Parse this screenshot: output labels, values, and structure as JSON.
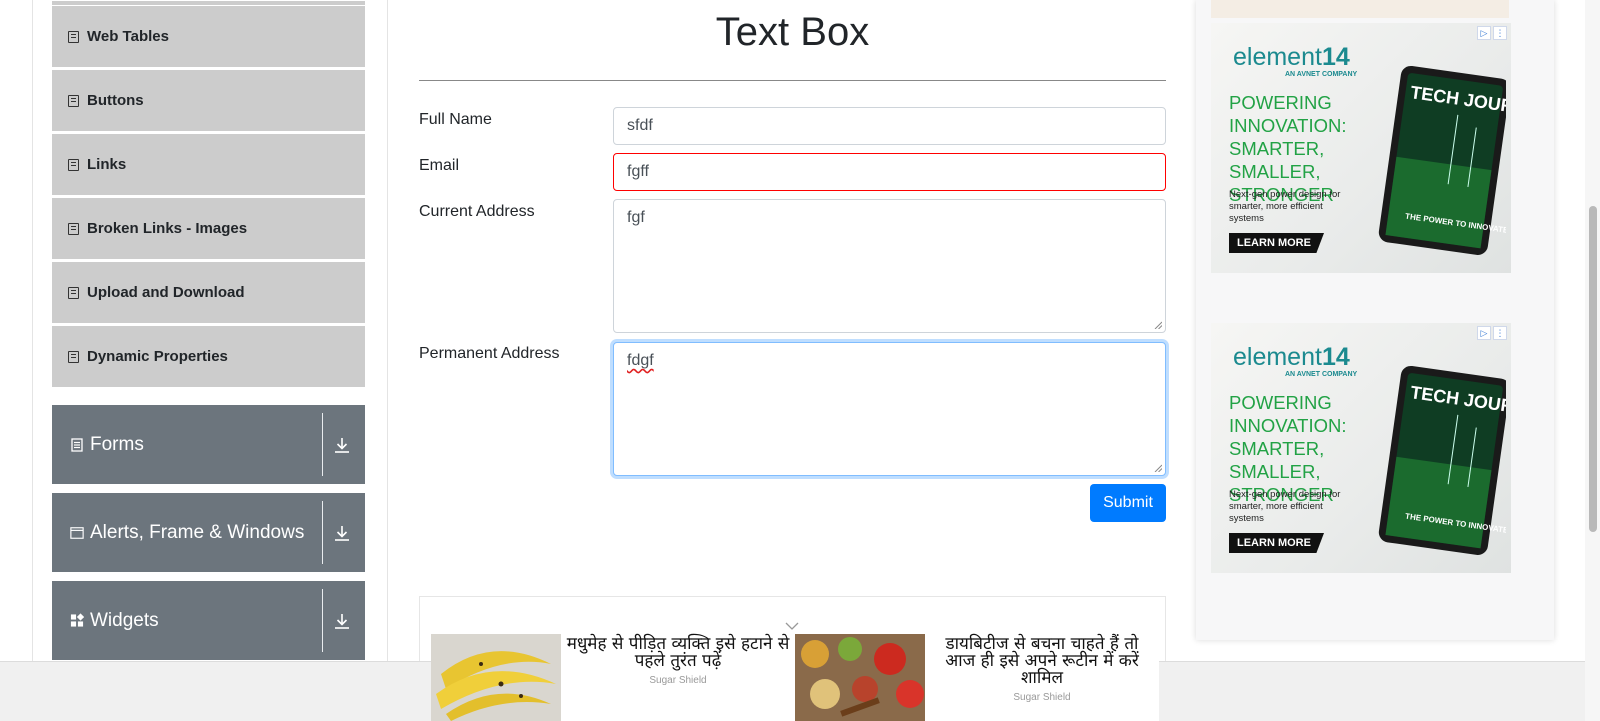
{
  "sidebar": {
    "items": [
      {
        "label": "Web Tables"
      },
      {
        "label": "Buttons"
      },
      {
        "label": "Links"
      },
      {
        "label": "Broken Links - Images"
      },
      {
        "label": "Upload and Download"
      },
      {
        "label": "Dynamic Properties"
      }
    ],
    "groups": [
      {
        "label": "Forms",
        "icon": "form-icon"
      },
      {
        "label": "Alerts, Frame & Windows",
        "icon": "window-icon"
      },
      {
        "label": "Widgets",
        "icon": "widgets-icon"
      }
    ]
  },
  "page": {
    "title": "Text Box"
  },
  "form": {
    "full_name_label": "Full Name",
    "full_name_value": "sfdf",
    "email_label": "Email",
    "email_value": "fgff",
    "current_address_label": "Current Address",
    "current_address_value": "fgf",
    "permanent_address_label": "Permanent Address",
    "permanent_address_value": "fdgf",
    "submit_label": "Submit"
  },
  "right_ads": [
    {
      "brand": "element",
      "brand_num": "14",
      "brand_sub": "AN AVNET COMPANY",
      "headline": "POWERING INNOVATION: SMARTER, SMALLER, STRONGER",
      "body": "Next-gen power design for smarter, more efficient systems",
      "cta": "LEARN MORE",
      "tablet_title": "TECH JOURNAL",
      "tablet_tag": "THE POWER TO INNOVATE"
    },
    {
      "brand": "element",
      "brand_num": "14",
      "brand_sub": "AN AVNET COMPANY",
      "headline": "POWERING INNOVATION: SMARTER, SMALLER, STRONGER",
      "body": "Next-gen power design for smarter, more efficient systems",
      "cta": "LEARN MORE",
      "tablet_title": "TECH JOURNAL",
      "tablet_tag": "THE POWER TO INNOVATE"
    }
  ],
  "bottom_ads": [
    {
      "headline": "मधुमेह से पीड़ित व्यक्ति इसे हटाने से पहले तुरंत पढ़ें",
      "source": "Sugar Shield"
    },
    {
      "headline": "डायबिटीज से बचना चाहते हैं तो आज ही इसे अपने रूटीन में करें शामिल",
      "source": "Sugar Shield"
    }
  ],
  "colors": {
    "primary": "#007bff",
    "sidebar_item_bg": "#cccccc",
    "group_bg": "#6c757d",
    "error": "#ff0000",
    "ad_green": "#22a245",
    "ad_teal": "#1b8a8f"
  }
}
